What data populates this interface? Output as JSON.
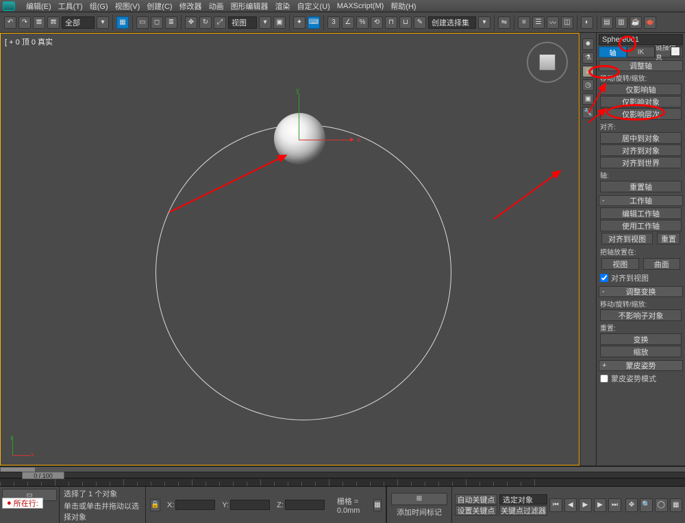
{
  "menu": [
    "编辑(E)",
    "工具(T)",
    "组(G)",
    "视图(V)",
    "创建(C)",
    "修改器",
    "动画",
    "图形编辑器",
    "渲染",
    "自定义(U)",
    "MAXScript(M)",
    "帮助(H)"
  ],
  "toolbar": {
    "set": "全部",
    "viewLabel": "视图",
    "createSet": "创建选择集"
  },
  "viewport": {
    "label": "[ + 0 顶 0 真实",
    "axisX": "x",
    "axisY": "y"
  },
  "side": {
    "objName": "Sphere001",
    "tabs": {
      "axis": "轴",
      "ik": "IK",
      "link": "链接信息"
    },
    "rollAdjust": "调整轴",
    "grpMoveRotScale": "移动/旋转/缩放:",
    "btnAffectPivot": "仅影响轴",
    "btnAffectObject": "仅影响对象",
    "btnAffectHierarchy": "仅影响层次",
    "grpAlign": "对齐:",
    "btnCenterObj": "居中到对象",
    "btnAlignObj": "对齐到对象",
    "btnAlignWorld": "对齐到世界",
    "grpAxis": "轴:",
    "btnResetAxis": "重置轴",
    "rollWork": "工作轴",
    "btnEditWork": "编辑工作轴",
    "btnUseWork": "使用工作轴",
    "btnAlignView": "对齐到视图",
    "btnReset": "重置",
    "grpPlace": "把轴放置在:",
    "btnView": "视图",
    "btnSurface": "曲面",
    "chkAlignToView": "对齐到视图",
    "rollTransform": "调整变换",
    "grpMoveRotScale2": "移动/旋转/缩放:",
    "btnNoChild": "不影响子对象",
    "grpReset": "重置:",
    "btnTransform": "变换",
    "btnScale": "缩放",
    "rollSkin": "蒙皮姿势",
    "chkSkinMode": "蒙皮姿势模式"
  },
  "status": {
    "nowline": "所在行:",
    "sel": "选择了 1 个对象",
    "hint": "单击或单击并拖动以选择对象",
    "x": "X:",
    "y": "Y:",
    "z": "Z:",
    "xv": "",
    "yv": "",
    "zv": "",
    "grid": "栅格 = 0.0mm",
    "addTimeTag": "添加时间标记",
    "autoKey": "自动关键点",
    "selObj": "选定对象",
    "setKey": "设置关键点",
    "keyFilter": "关键点过滤器"
  },
  "timeline": {
    "label": "0 / 100"
  }
}
